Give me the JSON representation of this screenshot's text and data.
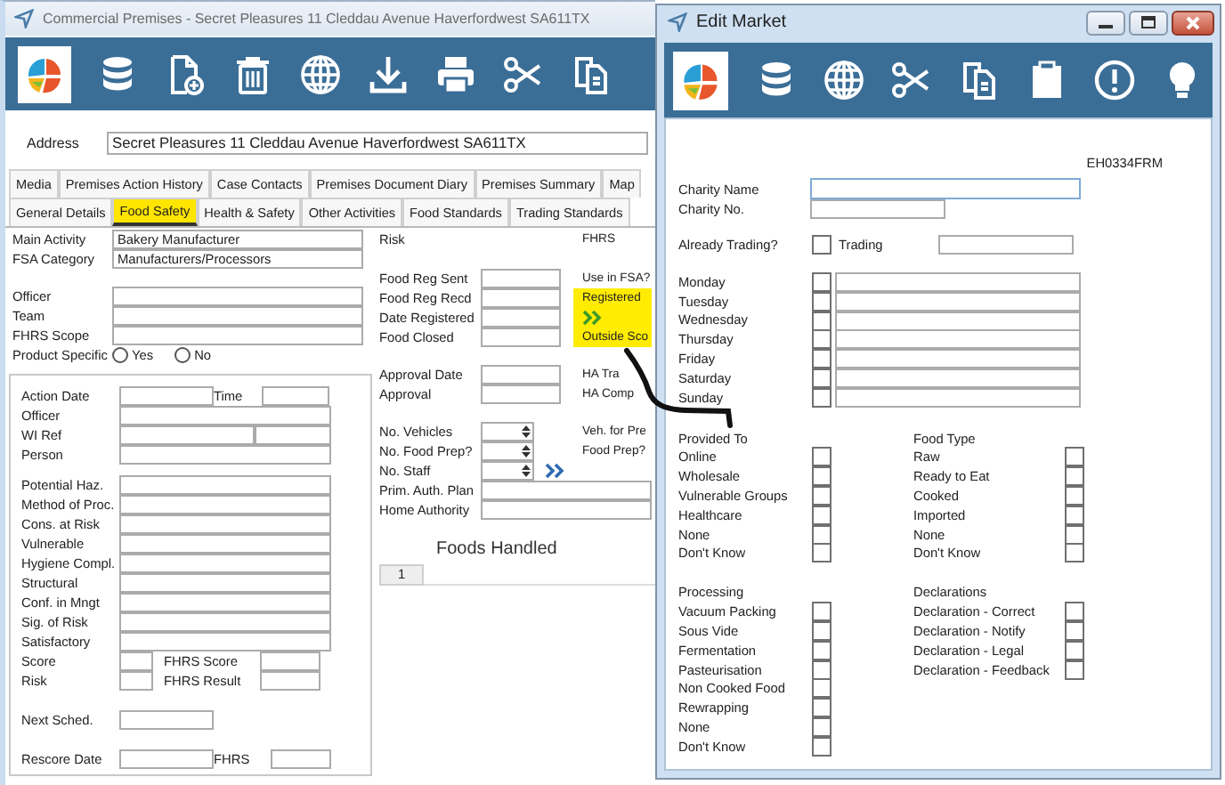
{
  "main_window": {
    "title": "Commercial Premises - Secret Pleasures 11 Cleddau Avenue Haverfordwest SA611TX",
    "address": {
      "label": "Address",
      "value": "Secret Pleasures 11 Cleddau Avenue Haverfordwest SA611TX"
    },
    "tab_rows": [
      {
        "tabs": [
          {
            "label": "Media",
            "selected": false
          },
          {
            "label": "Premises Action History",
            "selected": false
          },
          {
            "label": "Case Contacts",
            "selected": false
          },
          {
            "label": "Premises Document Diary",
            "selected": false
          },
          {
            "label": "Premises Summary",
            "selected": false
          },
          {
            "label": "Map",
            "selected": false
          }
        ]
      },
      {
        "tabs": [
          {
            "label": "General Details",
            "selected": false
          },
          {
            "label": "Food Safety",
            "selected": true
          },
          {
            "label": "Health & Safety",
            "selected": false
          },
          {
            "label": "Other Activities",
            "selected": false
          },
          {
            "label": "Food Standards",
            "selected": false
          },
          {
            "label": "Trading Standards",
            "selected": false
          }
        ]
      }
    ],
    "activity_fields": [
      {
        "label": "Main Activity",
        "value": "Bakery Manufacturer"
      },
      {
        "label": "FSA Category",
        "value": "Manufacturers/Processors"
      }
    ],
    "officer_fields": [
      {
        "label": "Officer"
      },
      {
        "label": "Team"
      },
      {
        "label": "FHRS Scope"
      }
    ],
    "product_specific": {
      "label": "Product Specific",
      "options": [
        {
          "label": "Yes",
          "selected": false
        },
        {
          "label": "No",
          "selected": false
        }
      ]
    },
    "action_rows": [
      {
        "kind": "date_time",
        "label": "Action Date",
        "label_2": "Time"
      },
      {
        "kind": "text",
        "label": "Officer"
      },
      {
        "kind": "split",
        "label": "WI Ref"
      },
      {
        "kind": "text",
        "label": "Person"
      }
    ],
    "risk_fields": [
      {
        "label": "Potential Haz."
      },
      {
        "label": "Method of Proc."
      },
      {
        "label": "Cons. at Risk"
      },
      {
        "label": "Vulnerable"
      },
      {
        "label": "Hygiene Compl."
      },
      {
        "label": "Structural"
      },
      {
        "label": "Conf. in Mngt"
      },
      {
        "label": "Sig. of Risk"
      },
      {
        "label": "Satisfactory"
      }
    ],
    "score_rows": [
      {
        "label": "Score",
        "label_2": "FHRS Score"
      },
      {
        "label": "Risk",
        "label_2": "FHRS Result"
      }
    ],
    "next_sched": {
      "label": "Next Sched."
    },
    "rescore": {
      "label": "Rescore Date",
      "label_2": "FHRS"
    },
    "risk_heading": "Risk",
    "registration_fields": [
      {
        "label": "Food Reg Sent"
      },
      {
        "label": "Food Reg Recd"
      },
      {
        "label": "Date Registered"
      },
      {
        "label": "Food Closed"
      }
    ],
    "approval_fields": [
      {
        "label": "Approval Date"
      },
      {
        "label": "Approval"
      }
    ],
    "count_fields": [
      {
        "label": "No. Vehicles"
      },
      {
        "label": "No. Food Prep?"
      },
      {
        "label": "No. Staff"
      }
    ],
    "authority_fields": [
      {
        "label": "Prim. Auth. Plan"
      },
      {
        "label": "Home Authority"
      }
    ],
    "foods_handled": {
      "title": "Foods Handled",
      "rows": [
        "1"
      ]
    },
    "fhrs_panel": {
      "title": "FHRS",
      "labels": [
        "Use in FSA?",
        "Registered",
        "Outside Sco",
        "HA Tra",
        "HA Comp",
        "Veh. for Pre",
        "Food Prep?"
      ]
    }
  },
  "edit_window": {
    "title": "Edit Market",
    "form_code": "EH0334FRM",
    "charity_name": {
      "label": "Charity Name",
      "focused": true
    },
    "charity_no": {
      "label": "Charity No."
    },
    "already_trading": {
      "label": "Already Trading?",
      "checked": false
    },
    "trading": {
      "label": "Trading"
    },
    "days": [
      {
        "label": "Monday",
        "checked": false
      },
      {
        "label": "Tuesday",
        "checked": false
      },
      {
        "label": "Wednesday",
        "checked": false
      },
      {
        "label": "Thursday",
        "checked": false
      },
      {
        "label": "Friday",
        "checked": false
      },
      {
        "label": "Saturday",
        "checked": false
      },
      {
        "label": "Sunday",
        "checked": false
      }
    ],
    "sections": [
      {
        "title": "Provided To",
        "options": [
          {
            "label": "Online",
            "checked": false
          },
          {
            "label": "Wholesale",
            "checked": false
          },
          {
            "label": "Vulnerable Groups",
            "checked": false
          },
          {
            "label": "Healthcare",
            "checked": false
          },
          {
            "label": "None",
            "checked": false
          },
          {
            "label": "Don't Know",
            "checked": false
          }
        ]
      },
      {
        "title": "Food Type",
        "options": [
          {
            "label": "Raw",
            "checked": false
          },
          {
            "label": "Ready to Eat",
            "checked": false
          },
          {
            "label": "Cooked",
            "checked": false
          },
          {
            "label": "Imported",
            "checked": false
          },
          {
            "label": "None",
            "checked": false
          },
          {
            "label": "Don't Know",
            "checked": false
          }
        ]
      },
      {
        "title": "Processing",
        "options": [
          {
            "label": "Vacuum Packing",
            "checked": false
          },
          {
            "label": "Sous Vide",
            "checked": false
          },
          {
            "label": "Fermentation",
            "checked": false
          },
          {
            "label": "Pasteurisation",
            "checked": false
          },
          {
            "label": "Non Cooked Food",
            "checked": false
          },
          {
            "label": "Rewrapping",
            "checked": false
          },
          {
            "label": "None",
            "checked": false
          },
          {
            "label": "Don't Know",
            "checked": false
          }
        ]
      },
      {
        "title": "Declarations",
        "options": [
          {
            "label": "Declaration - Correct",
            "checked": false
          },
          {
            "label": "Declaration - Notify",
            "checked": false
          },
          {
            "label": "Declaration - Legal",
            "checked": false
          },
          {
            "label": "Declaration - Feedback",
            "checked": false
          }
        ]
      }
    ]
  }
}
